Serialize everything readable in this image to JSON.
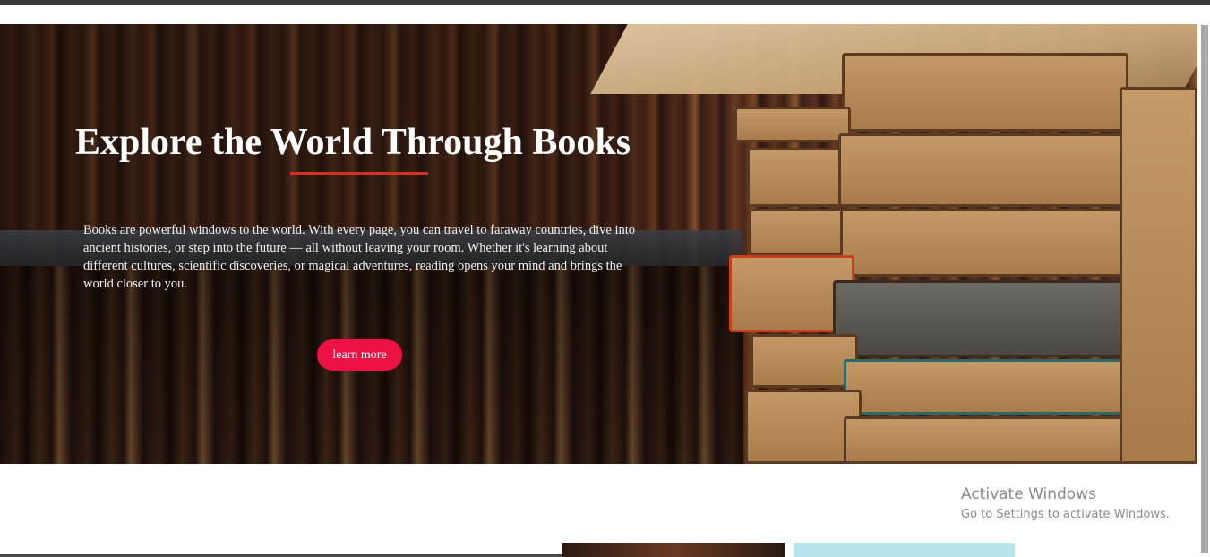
{
  "hero": {
    "title": "Explore the World Through Books",
    "description": "Books are powerful windows to the world. With every page, you can travel to faraway countries, dive into ancient histories, or step into the future — all without leaving your room. Whether it's learning about different cultures, scientific discoveries, or magical adventures, reading opens your mind and brings the world closer to you.",
    "cta_label": "learn more",
    "accent_color": "#ee1144",
    "underline_color": "#d2321e",
    "background_image": "bookshelf-with-book-stack"
  },
  "os_watermark": {
    "title": "Activate Windows",
    "subtitle": "Go to Settings to activate Windows."
  }
}
